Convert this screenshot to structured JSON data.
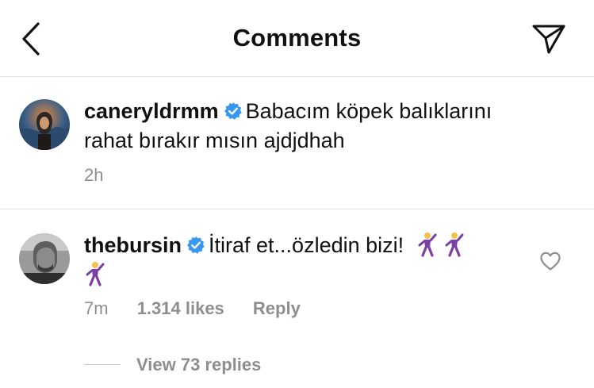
{
  "header": {
    "title": "Comments",
    "back_icon": "chevron-left-icon",
    "send_icon": "send-icon"
  },
  "comments": [
    {
      "username": "caneryldrmm",
      "verified": true,
      "text": "Babacım köpek balıklarını rahat bırakır mısın ajdjdhah",
      "time": "2h",
      "avatar_colors": [
        "#2b4f73",
        "#e0803a"
      ]
    },
    {
      "username": "thebursin",
      "verified": true,
      "text": "İtiraf et...özledin bizi!",
      "emoji": "dancing-man-emoji",
      "emoji_count": 3,
      "time": "7m",
      "likes": "1.314 likes",
      "reply_label": "Reply",
      "view_replies": "View 73 replies",
      "like_icon": "heart-outline-icon"
    }
  ],
  "colors": {
    "text": "#111111",
    "meta": "#8e8e8e",
    "verified": "#3897f0",
    "divider": "#e3e3e3",
    "emoji_purple": "#7a3fa5"
  }
}
